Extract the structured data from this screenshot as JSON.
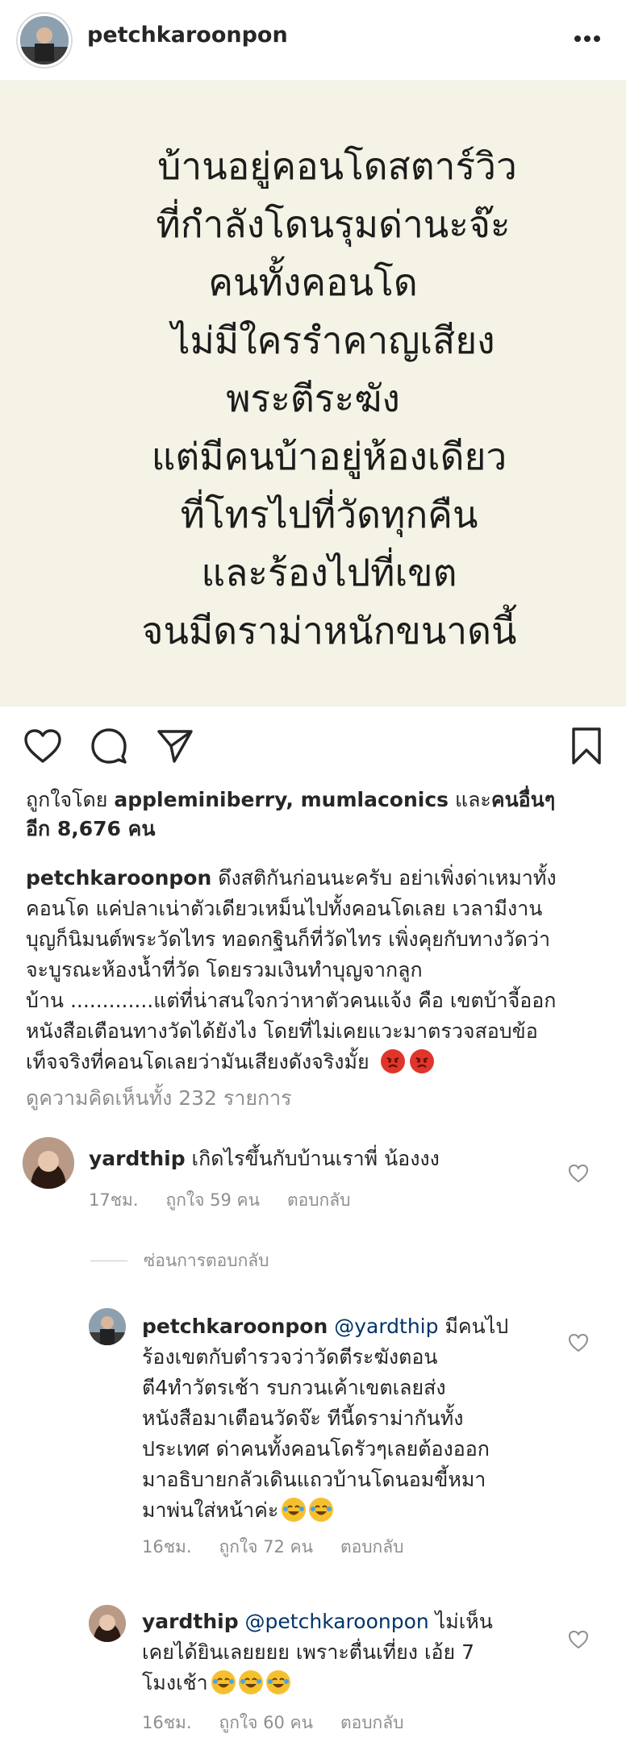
{
  "header": {
    "username": "petchkaroonpon",
    "more_icon": "more-horizontal-icon"
  },
  "post": {
    "background_color": "#f4f3e6",
    "lines": [
      "บ้านอยู่คอนโดสตาร์วิว",
      "ที่กำลังโดนรุมด่านะจ๊ะ",
      "คนทั้งคอนโด",
      "ไม่มีใครรำคาญเสียง",
      "พระตีระฆัง",
      "แต่มีคนบ้าอยู่ห้องเดียว",
      "ที่โทรไปที่วัดทุกคืน",
      "และร้องไปที่เขต",
      "จนมีดราม่าหนักขนาดนี้"
    ]
  },
  "actions": {
    "like_icon": "heart-outline-icon",
    "comment_icon": "comment-bubble-icon",
    "share_icon": "paper-plane-icon",
    "save_icon": "bookmark-icon"
  },
  "likes": {
    "prefix": "ถูกใจโดย ",
    "users": "appleminiberry, mumlaconics",
    "middle": " และ",
    "others_label": "คนอื่นๆ",
    "line2": "อีก 8,676 คน"
  },
  "caption": {
    "username": "petchkaroonpon",
    "text": " ดึงสติกันก่อนนะครับ อย่าเพิ่งด่าเหมาทั้ง\nคอนโด แค่ปลาเน่าตัวเดียวเหม็นไปทั้งคอนโดเลย เวลามีงาน\nบุญก็นิมนต์พระวัดไทร ทอดกฐินก็ที่วัดไทร เพิ่งคุยกับทางวัดว่า\nจะบูรณะห้องน้ำที่วัด โดยรวมเงินทำบุญจากลูก\nบ้าน .............แต่ที่น่าสนใจกว่าหาตัวคนแจ้ง คือ เขตบ้าจี้ออก\nหนังสือเตือนทางวัดได้ยังไง โดยที่ไม่เคยแวะมาตรวจสอบข้อ\nเท็จจริงที่คอนโดเลยว่ามันเสียงดังจริงมั้ย",
    "emoji": "angry-face-icon"
  },
  "view_all_comments": "ดูความคิดเห็นทั้ง 232 รายการ",
  "comments": [
    {
      "username": "yardthip",
      "text": " เกิดไรขึ้นกับบ้านเราพี่ น้องงง",
      "time": "17ชม.",
      "likes": "ถูกใจ 59 คน",
      "reply": "ตอบกลับ"
    }
  ],
  "hide_replies": "ซ่อนการตอบกลับ",
  "replies": [
    {
      "username": "petchkaroonpon",
      "mention": " @yardthip",
      "text": " มีคนไป\nร้องเขตกับตำรวจว่าวัดตีระฆังตอน\nตี4ทำวัตรเช้า รบกวนเค้าเขตเลยส่ง\nหนังสือมาเตือนวัดจ๊ะ ทีนี้ดราม่ากันทั้ง\nประเทศ ด่าคนทั้งคอนโดรัวๆเลยต้องออก\nมาอธิบายกลัวเดินแถวบ้านโดนอมขี้หมา\nมาพ่นใส่หน้าค่ะ",
      "time": "16ชม.",
      "likes": "ถูกใจ 72 คน",
      "reply": "ตอบกลับ"
    },
    {
      "username": "yardthip",
      "mention": " @petchkaroonpon",
      "text": " ไม่เห็น\nเคยได้ยินเลยยยย เพราะตื่นเที่ยง เอ้ย 7\nโมงเช้า",
      "time": "16ชม.",
      "likes": "ถูกใจ 60 คน",
      "reply": "ตอบกลับ"
    }
  ]
}
